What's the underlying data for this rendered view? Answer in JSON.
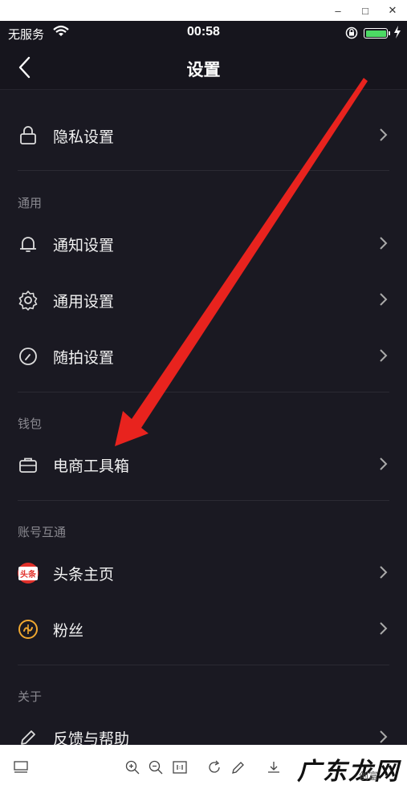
{
  "window": {
    "minimize": "–",
    "maximize": "□",
    "close": "✕"
  },
  "status_bar": {
    "carrier": "无服务",
    "time": "00:58"
  },
  "nav": {
    "title": "设置"
  },
  "rows": {
    "privacy": "隐私设置",
    "notify": "通知设置",
    "general": "通用设置",
    "shoot": "随拍设置",
    "shop": "电商工具箱",
    "toutiao": "头条主页",
    "fans": "粉丝",
    "feedback": "反馈与帮助"
  },
  "sections": {
    "general": "通用",
    "wallet": "钱包",
    "account": "账号互通",
    "about": "关于"
  },
  "toutiao_badge": "头条",
  "watermark": {
    "main": "广东龙网",
    "sub": "创富"
  },
  "colors": {
    "background": "#1a1922",
    "arrow": "#e8231e",
    "battery": "#4cd964",
    "fans_icon": "#f0a830"
  }
}
